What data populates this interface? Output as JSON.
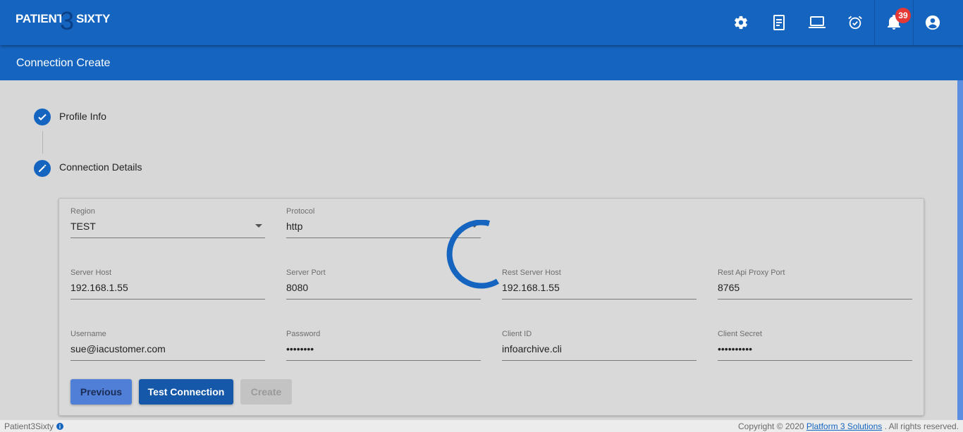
{
  "app": {
    "logo_left": "PATIENT",
    "logo_mid": "3",
    "logo_right": "SIXTY",
    "notification_count": "39"
  },
  "page": {
    "title": "Connection Create"
  },
  "steps": [
    {
      "label": "Profile Info",
      "state": "done",
      "icon": "check-icon"
    },
    {
      "label": "Connection Details",
      "state": "editing",
      "icon": "pencil-icon"
    }
  ],
  "form": {
    "region": {
      "label": "Region",
      "value": "TEST"
    },
    "protocol": {
      "label": "Protocol",
      "value": "http"
    },
    "server_host": {
      "label": "Server Host",
      "value": "192.168.1.55"
    },
    "server_port": {
      "label": "Server Port",
      "value": "8080"
    },
    "rest_server_host": {
      "label": "Rest Server Host",
      "value": "192.168.1.55"
    },
    "rest_api_proxy_port": {
      "label": "Rest Api Proxy Port",
      "value": "8765"
    },
    "username": {
      "label": "Username",
      "value": "sue@iacustomer.com"
    },
    "password": {
      "label": "Password",
      "value": "••••••••"
    },
    "client_id": {
      "label": "Client ID",
      "value": "infoarchive.cli"
    },
    "client_secret": {
      "label": "Client Secret",
      "value": "••••••••••"
    }
  },
  "buttons": {
    "previous": "Previous",
    "test_connection": "Test Connection",
    "create": "Create"
  },
  "footer": {
    "app_name": "Patient3Sixty",
    "info_icon_text": "i",
    "copyright": "Copyright © 2020",
    "company_link": "Platform 3 Solutions",
    "rights": ". All rights reserved."
  },
  "colors": {
    "primary": "#1565c0",
    "badge": "#e53935",
    "background": "#d7d7d7"
  }
}
